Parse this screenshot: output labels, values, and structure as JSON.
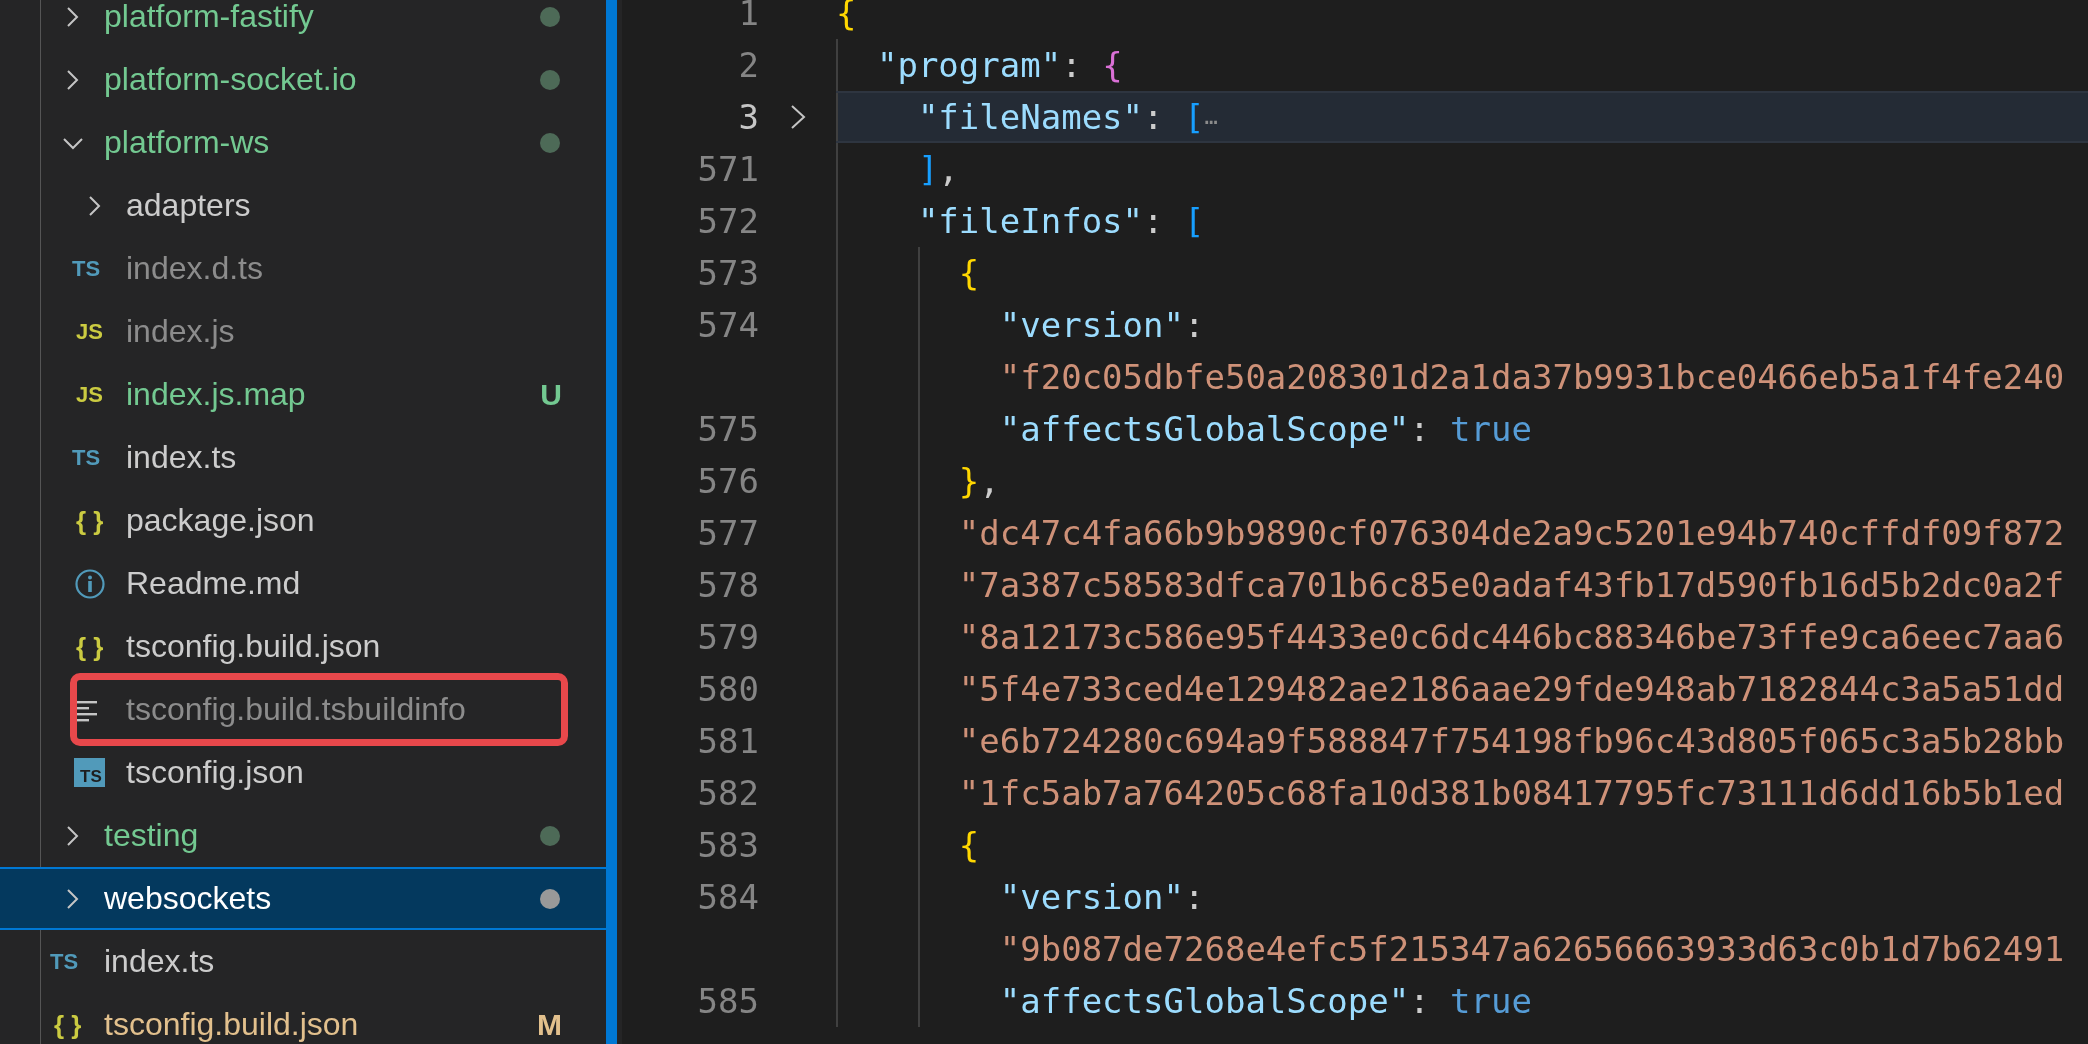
{
  "explorer": {
    "items": [
      {
        "name": "platform-fastify",
        "kind": "folder",
        "expanded": false,
        "selected": false,
        "highlighted": false,
        "color": "#73c991",
        "dot": true
      },
      {
        "name": "platform-socket.io",
        "kind": "folder",
        "expanded": false,
        "selected": false,
        "highlighted": false,
        "color": "#73c991",
        "dot": true
      },
      {
        "name": "platform-ws",
        "kind": "folder",
        "expanded": true,
        "selected": false,
        "highlighted": false,
        "color": "#73c991",
        "dot": true,
        "children": [
          {
            "name": "adapters",
            "kind": "folder",
            "expanded": false,
            "selected": false,
            "highlighted": false,
            "color": "#cccccc",
            "dot": false
          },
          {
            "name": "index.d.ts",
            "kind": "ts",
            "icon_text": "TS",
            "selected": false,
            "highlighted": false,
            "color": "#8c8c8c",
            "dot": false
          },
          {
            "name": "index.js",
            "kind": "js",
            "icon_text": "JS",
            "selected": false,
            "highlighted": false,
            "color": "#8c8c8c",
            "dot": false
          },
          {
            "name": "index.js.map",
            "kind": "js",
            "icon_text": "JS",
            "selected": false,
            "highlighted": false,
            "color": "#73c991",
            "dot": false,
            "badge": "U"
          },
          {
            "name": "index.ts",
            "kind": "ts",
            "icon_text": "TS",
            "selected": false,
            "highlighted": false,
            "color": "#cccccc",
            "dot": false
          },
          {
            "name": "package.json",
            "kind": "json",
            "icon_text": "{ }",
            "selected": false,
            "highlighted": false,
            "color": "#cccccc",
            "dot": false
          },
          {
            "name": "Readme.md",
            "kind": "readme",
            "selected": false,
            "highlighted": false,
            "color": "#cccccc",
            "dot": false
          },
          {
            "name": "tsconfig.build.json",
            "kind": "json",
            "icon_text": "{ }",
            "selected": false,
            "highlighted": false,
            "color": "#cccccc",
            "dot": false
          },
          {
            "name": "tsconfig.build.tsbuildinfo",
            "kind": "text",
            "selected": false,
            "highlighted": true,
            "color": "#8c8c8c",
            "dot": false
          },
          {
            "name": "tsconfig.json",
            "kind": "tsconfig",
            "icon_text": "TS",
            "selected": false,
            "highlighted": false,
            "color": "#cccccc",
            "dot": false
          }
        ]
      },
      {
        "name": "testing",
        "kind": "folder",
        "expanded": false,
        "selected": false,
        "highlighted": false,
        "color": "#73c991",
        "dot": true
      },
      {
        "name": "websockets",
        "kind": "folder",
        "expanded": false,
        "selected": true,
        "highlighted": false,
        "color": "#ffffff",
        "dot": true
      },
      {
        "name": "index.ts",
        "kind": "ts",
        "icon_text": "TS",
        "selected": false,
        "highlighted": false,
        "color": "#cccccc",
        "dot": false
      },
      {
        "name": "tsconfig.build.json",
        "kind": "json",
        "icon_text": "{ }",
        "selected": false,
        "highlighted": false,
        "color": "#e2c08d",
        "dot": false,
        "badge": "M"
      }
    ]
  },
  "editor": {
    "lines": [
      {
        "number": "1",
        "current": false,
        "folded": false,
        "tokens": [
          {
            "text": "{",
            "kind": "brace1"
          }
        ],
        "children": [
          {
            "number": "2",
            "current": false,
            "folded": false,
            "tokens": [
              {
                "text": "\"program\"",
                "kind": "key"
              },
              {
                "text": ": ",
                "kind": "punct"
              },
              {
                "text": "{",
                "kind": "brace2"
              }
            ],
            "children": [
              {
                "number": "3",
                "current": true,
                "folded": true,
                "tokens": [
                  {
                    "text": "\"fileNames\"",
                    "kind": "key"
                  },
                  {
                    "text": ": ",
                    "kind": "punct"
                  },
                  {
                    "text": "[",
                    "kind": "brace3"
                  },
                  {
                    "text": "⋯",
                    "kind": "ellipsis"
                  }
                ]
              },
              {
                "number": "571",
                "current": false,
                "folded": false,
                "tokens": [
                  {
                    "text": "]",
                    "kind": "brace3"
                  },
                  {
                    "text": ",",
                    "kind": "punct"
                  }
                ]
              },
              {
                "number": "572",
                "current": false,
                "folded": false,
                "tokens": [
                  {
                    "text": "\"fileInfos\"",
                    "kind": "key"
                  },
                  {
                    "text": ": ",
                    "kind": "punct"
                  },
                  {
                    "text": "[",
                    "kind": "brace3"
                  }
                ],
                "children": [
                  {
                    "number": "573",
                    "current": false,
                    "folded": false,
                    "tokens": [
                      {
                        "text": "{",
                        "kind": "brace1"
                      }
                    ],
                    "children": [
                      {
                        "number": "574",
                        "current": false,
                        "folded": false,
                        "tokens": [
                          {
                            "text": "\"version\"",
                            "kind": "key"
                          },
                          {
                            "text": ":",
                            "kind": "punct"
                          }
                        ]
                      },
                      {
                        "current": false,
                        "folded": false,
                        "tokens": [
                          {
                            "text": "\"f20c05dbfe50a208301d2a1da37b9931bce0466eb5a1f4fe240",
                            "kind": "string"
                          }
                        ]
                      },
                      {
                        "number": "575",
                        "current": false,
                        "folded": false,
                        "tokens": [
                          {
                            "text": "\"affectsGlobalScope\"",
                            "kind": "key"
                          },
                          {
                            "text": ": ",
                            "kind": "punct"
                          },
                          {
                            "text": "true",
                            "kind": "bool"
                          }
                        ]
                      }
                    ]
                  },
                  {
                    "number": "576",
                    "current": false,
                    "folded": false,
                    "tokens": [
                      {
                        "text": "}",
                        "kind": "brace1"
                      },
                      {
                        "text": ",",
                        "kind": "punct"
                      }
                    ]
                  },
                  {
                    "number": "577",
                    "current": false,
                    "folded": false,
                    "tokens": [
                      {
                        "text": "\"dc47c4fa66b9b9890cf076304de2a9c5201e94b740cffdf09f872",
                        "kind": "string"
                      }
                    ]
                  },
                  {
                    "number": "578",
                    "current": false,
                    "folded": false,
                    "tokens": [
                      {
                        "text": "\"7a387c58583dfca701b6c85e0adaf43fb17d590fb16d5b2dc0a2f",
                        "kind": "string"
                      }
                    ]
                  },
                  {
                    "number": "579",
                    "current": false,
                    "folded": false,
                    "tokens": [
                      {
                        "text": "\"8a12173c586e95f4433e0c6dc446bc88346be73ffe9ca6eec7aa6",
                        "kind": "string"
                      }
                    ]
                  },
                  {
                    "number": "580",
                    "current": false,
                    "folded": false,
                    "tokens": [
                      {
                        "text": "\"5f4e733ced4e129482ae2186aae29fde948ab7182844c3a5a51dd",
                        "kind": "string"
                      }
                    ]
                  },
                  {
                    "number": "581",
                    "current": false,
                    "folded": false,
                    "tokens": [
                      {
                        "text": "\"e6b724280c694a9f588847f754198fb96c43d805f065c3a5b28bb",
                        "kind": "string"
                      }
                    ]
                  },
                  {
                    "number": "582",
                    "current": false,
                    "folded": false,
                    "tokens": [
                      {
                        "text": "\"1fc5ab7a764205c68fa10d381b08417795fc73111d6dd16b5b1ed",
                        "kind": "string"
                      }
                    ]
                  },
                  {
                    "number": "583",
                    "current": false,
                    "folded": false,
                    "tokens": [
                      {
                        "text": "{",
                        "kind": "brace1"
                      }
                    ],
                    "children": [
                      {
                        "number": "584",
                        "current": false,
                        "folded": false,
                        "tokens": [
                          {
                            "text": "\"version\"",
                            "kind": "key"
                          },
                          {
                            "text": ":",
                            "kind": "punct"
                          }
                        ]
                      },
                      {
                        "current": false,
                        "folded": false,
                        "tokens": [
                          {
                            "text": "\"9b087de7268e4efc5f215347a62656663933d63c0b1d7b62491",
                            "kind": "string"
                          }
                        ]
                      },
                      {
                        "number": "585",
                        "current": false,
                        "folded": false,
                        "tokens": [
                          {
                            "text": "\"affectsGlobalScope\"",
                            "kind": "key"
                          },
                          {
                            "text": ": ",
                            "kind": "punct"
                          },
                          {
                            "text": "true",
                            "kind": "bool"
                          }
                        ]
                      }
                    ]
                  }
                ]
              }
            ]
          }
        ]
      }
    ]
  }
}
